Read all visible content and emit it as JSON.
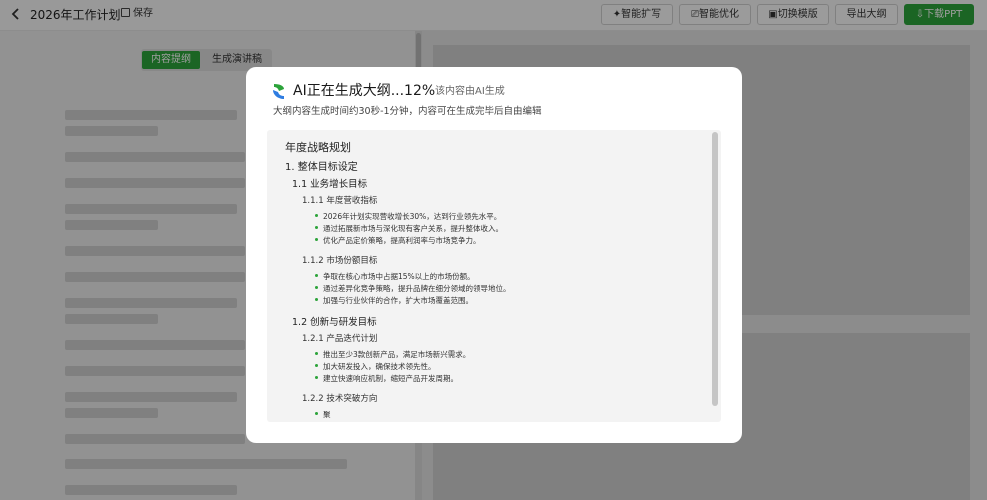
{
  "topbar": {
    "title": "2026年工作计划",
    "save_label": "保存",
    "buttons": [
      {
        "label": "✦智能扩写"
      },
      {
        "label": "⎚智能优化"
      },
      {
        "label": "▣切换模版"
      },
      {
        "label": "导出大纲"
      },
      {
        "label": "⇩下载PPT"
      }
    ]
  },
  "left_tabs": {
    "outline": "内容提纲",
    "speech": "生成演讲稿"
  },
  "modal": {
    "title": "AI正在生成大纲...12%",
    "ai_note": "该内容由AI生成",
    "subtitle": "大纲内容生成时间约30秒-1分钟，内容可在生成完毕后自由编辑",
    "progress_percent": 12,
    "outline": {
      "root": "年度战略规划",
      "l1": "1. 整体目标设定",
      "s11": "1.1 业务增长目标",
      "s111": "1.1.1 年度营收指标",
      "b111": [
        "2026年计划实现营收增长30%，达到行业领先水平。",
        "通过拓展新市场与深化现有客户关系，提升整体收入。",
        "优化产品定价策略，提高利润率与市场竞争力。"
      ],
      "s112": "1.1.2 市场份额目标",
      "b112": [
        "争取在核心市场中占据15%以上的市场份额。",
        "通过差异化竞争策略，提升品牌在细分领域的领导地位。",
        "加强与行业伙伴的合作，扩大市场覆盖范围。"
      ],
      "s12": "1.2 创新与研发目标",
      "s121": "1.2.1 产品迭代计划",
      "b121": [
        "推出至少3款创新产品，满足市场新兴需求。",
        "加大研发投入，确保技术领先性。",
        "建立快速响应机制，缩短产品开发周期。"
      ],
      "s122": "1.2.2 技术突破方向",
      "b122": [
        "聚"
      ]
    }
  },
  "colors": {
    "accent": "#2ca33a",
    "overlay": "rgba(0,0,0,0.38)"
  }
}
